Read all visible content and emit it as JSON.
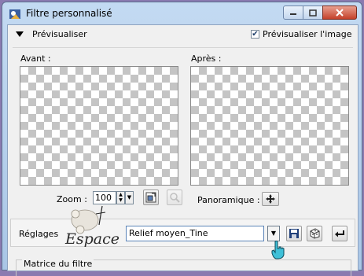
{
  "window": {
    "title": "Filtre personnalisé",
    "buttons": {
      "minimize": "minimize-icon",
      "maximize": "maximize-icon",
      "close": "close-icon"
    }
  },
  "preview": {
    "toggle_label": "Prévisualiser",
    "checkbox_label": "Prévisualiser l'image",
    "checkbox_checked": true,
    "before_label": "Avant :",
    "after_label": "Après :"
  },
  "zoom": {
    "label": "Zoom :",
    "value": "100"
  },
  "panoramique": {
    "label": "Panoramique :"
  },
  "settings": {
    "label": "Réglages",
    "preset_value": "Relief moyen_Tine"
  },
  "logo": {
    "text": "Espace"
  },
  "matrix": {
    "label": "Matrice du filtre"
  },
  "colors": {
    "title_bar": "#b8d0ec",
    "close_button": "#c4412a",
    "checker": "#c4c4c4",
    "cursor": "#3fc0d8"
  }
}
